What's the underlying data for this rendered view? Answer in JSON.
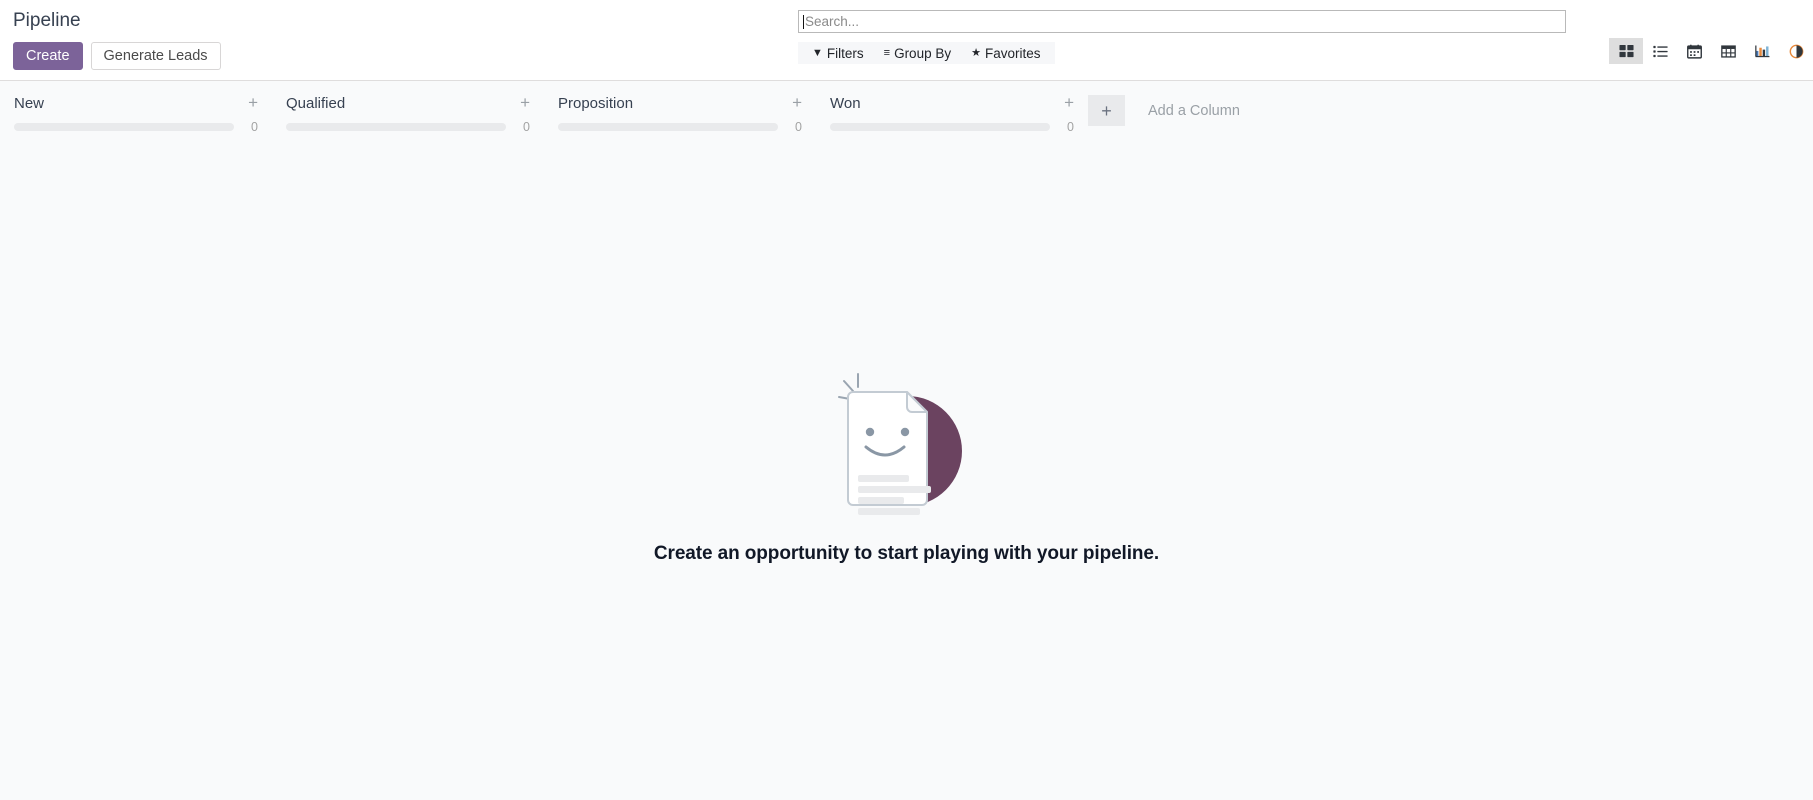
{
  "breadcrumb": {
    "title": "Pipeline"
  },
  "actions": {
    "create_label": "Create",
    "generate_leads_label": "Generate Leads"
  },
  "search": {
    "placeholder": "Search...",
    "value": ""
  },
  "filter_menus": [
    {
      "name": "filters",
      "label": "Filters",
      "glyph": "▼"
    },
    {
      "name": "group-by",
      "label": "Group By",
      "glyph": "≡"
    },
    {
      "name": "favorites",
      "label": "Favorites",
      "glyph": "★"
    }
  ],
  "view_switcher": {
    "active": "kanban",
    "views": [
      {
        "name": "kanban",
        "title": "Kanban"
      },
      {
        "name": "list",
        "title": "List"
      },
      {
        "name": "calendar",
        "title": "Calendar"
      },
      {
        "name": "pivot",
        "title": "Pivot"
      },
      {
        "name": "graph",
        "title": "Graph"
      },
      {
        "name": "cohort",
        "title": "Cohort"
      }
    ]
  },
  "kanban": {
    "columns": [
      {
        "title": "New",
        "count": "0",
        "add_title": "+"
      },
      {
        "title": "Qualified",
        "count": "0",
        "add_title": "+"
      },
      {
        "title": "Proposition",
        "count": "0",
        "add_title": "+"
      },
      {
        "title": "Won",
        "count": "0",
        "add_title": "+"
      }
    ],
    "add_column": {
      "label": "Add a Column",
      "plus": "+"
    }
  },
  "empty_state": {
    "message": "Create an opportunity to start playing with your pipeline."
  },
  "colors": {
    "primary": "#7C6399",
    "illustration_circle": "#6B4360",
    "page_background": "#F9FAFB",
    "panel_background": "#FFFFFF",
    "progress_track": "#E9EAEC",
    "muted_text": "#9AA0A6"
  }
}
